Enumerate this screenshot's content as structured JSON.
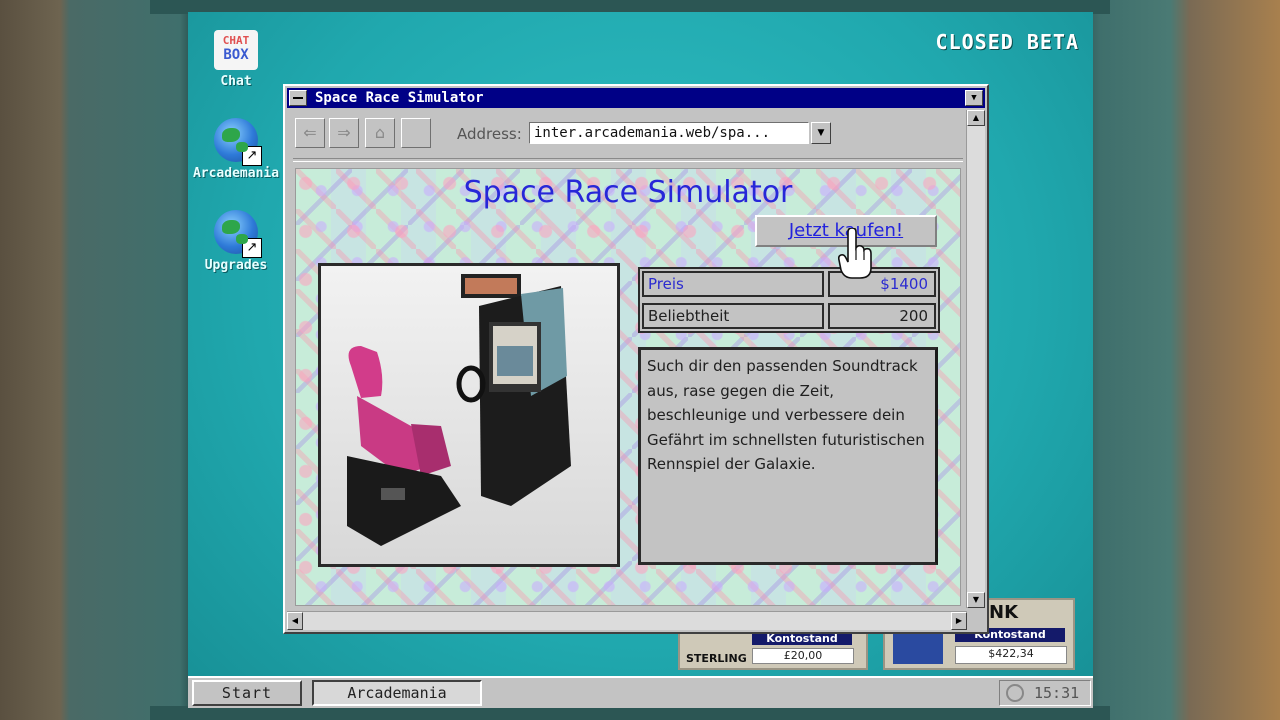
{
  "overlay": {
    "beta_label": "CLOSED BETA"
  },
  "desktop": {
    "icons": [
      {
        "label": "Chat",
        "logo_line1": "CHAT",
        "logo_line2": "BOX"
      },
      {
        "label": "Arcademania"
      },
      {
        "label": "Upgrades"
      }
    ]
  },
  "browser": {
    "title": "Space Race Simulator",
    "address_label": "Address:",
    "address_value": "inter.arcademania.web/spa...",
    "page": {
      "heading": "Space Race Simulator",
      "buy_label": "Jetzt kaufen!",
      "info": [
        {
          "key": "Preis",
          "value": "$1400"
        },
        {
          "key": "Beliebtheit",
          "value": "200"
        }
      ],
      "description": "Such dir den passenden Soundtrack aus, rase gegen die Zeit, beschleunige und verbessere dein Gefährt im schnellsten futuristischen Rennspiel der Galaxie."
    }
  },
  "bank_widgets": [
    {
      "brand": "STERLING",
      "label": "Kontostand",
      "value": "£20,00"
    },
    {
      "brand_fragment": "NK",
      "label": "Kontostand",
      "value": "$422,34"
    }
  ],
  "taskbar": {
    "start_label": "Start",
    "task_label": "Arcademania",
    "time": "15:31"
  },
  "colors": {
    "desktop": "#20a8ae",
    "titlebar": "#000086",
    "link": "#2222dd",
    "window": "#c3c3c3"
  }
}
